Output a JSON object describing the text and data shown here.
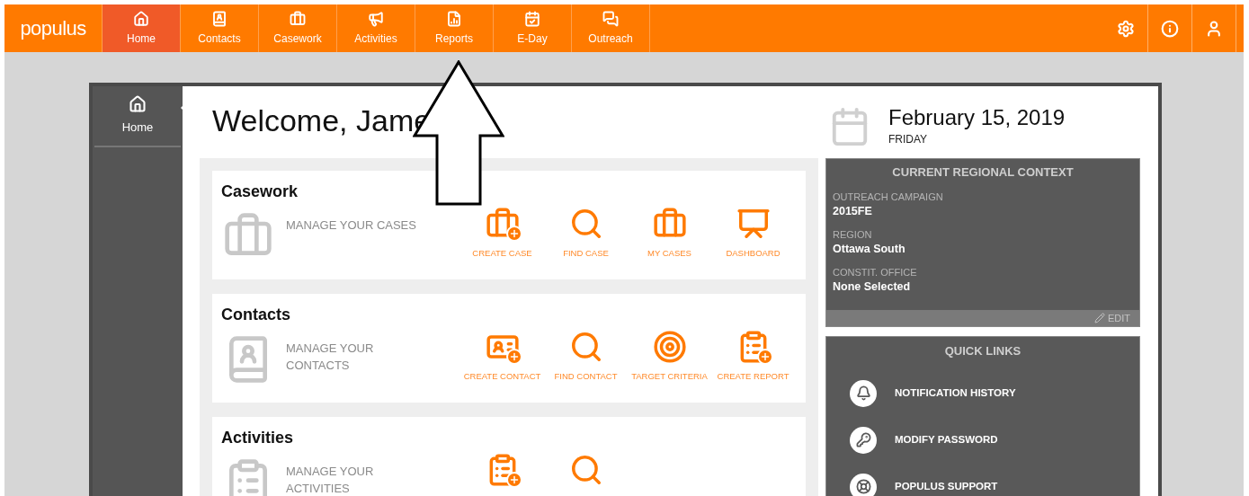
{
  "app": {
    "logo": "populus"
  },
  "nav": [
    {
      "kind": "home",
      "label": "Home",
      "selected": true
    },
    {
      "kind": "contacts",
      "label": "Contacts",
      "selected": false
    },
    {
      "kind": "casework",
      "label": "Casework",
      "selected": false
    },
    {
      "kind": "activities",
      "label": "Activities",
      "selected": false
    },
    {
      "kind": "reports",
      "label": "Reports",
      "selected": false
    },
    {
      "kind": "eday",
      "label": "E-Day",
      "selected": false
    },
    {
      "kind": "outreach",
      "label": "Outreach",
      "selected": false
    }
  ],
  "toolbar": [
    {
      "kind": "settings"
    },
    {
      "kind": "info"
    },
    {
      "kind": "user"
    }
  ],
  "sidebar": {
    "items": [
      {
        "kind": "home",
        "label": "Home",
        "selected": true
      }
    ]
  },
  "welcome": "Welcome, Jame",
  "date": {
    "day": "February 15, 2019",
    "weekday": "FRIDAY"
  },
  "sections": [
    {
      "title": "Casework",
      "kind": "casework",
      "description": "MANAGE YOUR CASES",
      "actions": [
        {
          "kind": "create-case",
          "label": "CREATE CASE"
        },
        {
          "kind": "find",
          "label": "FIND CASE"
        },
        {
          "kind": "my-cases",
          "label": "MY CASES"
        },
        {
          "kind": "dashboard",
          "label": "DASHBOARD"
        }
      ]
    },
    {
      "title": "Contacts",
      "kind": "contacts",
      "description": "MANAGE YOUR CONTACTS",
      "actions": [
        {
          "kind": "create-contact",
          "label": "CREATE CONTACT"
        },
        {
          "kind": "find",
          "label": "FIND CONTACT"
        },
        {
          "kind": "target",
          "label": "TARGET CRITERIA"
        },
        {
          "kind": "create-report",
          "label": "CREATE REPORT"
        }
      ]
    },
    {
      "title": "Activities",
      "kind": "activities",
      "description": "MANAGE YOUR ACTIVITIES",
      "actions": [
        {
          "kind": "create-report"
        },
        {
          "kind": "find"
        }
      ]
    }
  ],
  "context": {
    "title": "CURRENT REGIONAL CONTEXT",
    "fields": [
      {
        "label": "OUTREACH CAMPAIGN",
        "value": "2015FE"
      },
      {
        "label": "REGION",
        "value": "Ottawa South"
      },
      {
        "label": "CONSTIT. OFFICE",
        "value": "None Selected"
      }
    ],
    "edit": "EDIT"
  },
  "quick_links": {
    "title": "QUICK LINKS",
    "items": [
      {
        "kind": "bell",
        "label": "NOTIFICATION HISTORY"
      },
      {
        "kind": "password",
        "label": "MODIFY PASSWORD"
      },
      {
        "kind": "support",
        "label": "POPULUS SUPPORT"
      }
    ]
  },
  "annotation": {
    "kind": "up-arrow"
  }
}
